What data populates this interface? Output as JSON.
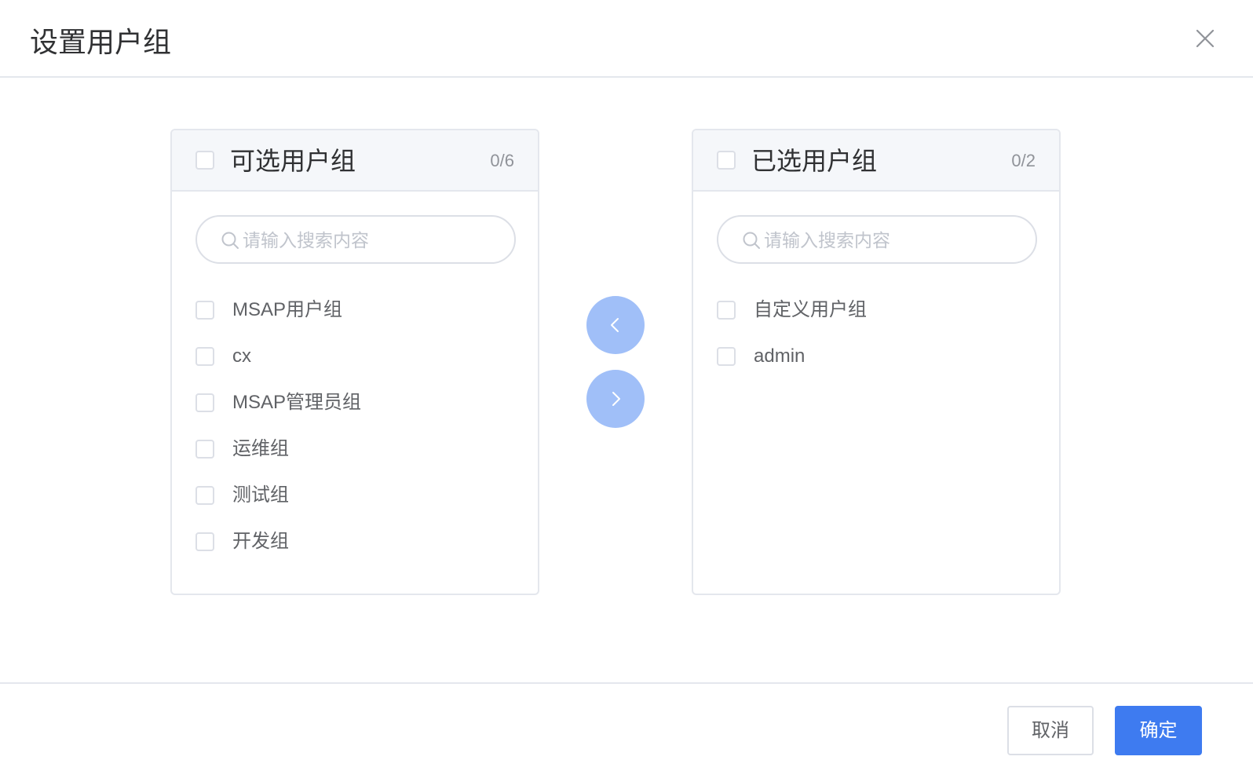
{
  "dialog": {
    "title": "设置用户组",
    "close_icon": "close-icon"
  },
  "transfer": {
    "left": {
      "title": "可选用户组",
      "count": "0/6",
      "search_placeholder": "请输入搜索内容",
      "items": [
        {
          "label": "MSAP用户组"
        },
        {
          "label": "cx"
        },
        {
          "label": "MSAP管理员组"
        },
        {
          "label": "运维组"
        },
        {
          "label": "测试组"
        },
        {
          "label": "开发组"
        }
      ]
    },
    "right": {
      "title": "已选用户组",
      "count": "0/2",
      "search_placeholder": "请输入搜索内容",
      "items": [
        {
          "label": "自定义用户组"
        },
        {
          "label": "admin"
        }
      ]
    },
    "move_left_icon": "chevron-left-icon",
    "move_right_icon": "chevron-right-icon"
  },
  "footer": {
    "cancel_label": "取消",
    "confirm_label": "确定"
  },
  "colors": {
    "primary": "#3e7bf0",
    "move_button_disabled": "#a0bff8",
    "border": "#dcdfe6"
  }
}
